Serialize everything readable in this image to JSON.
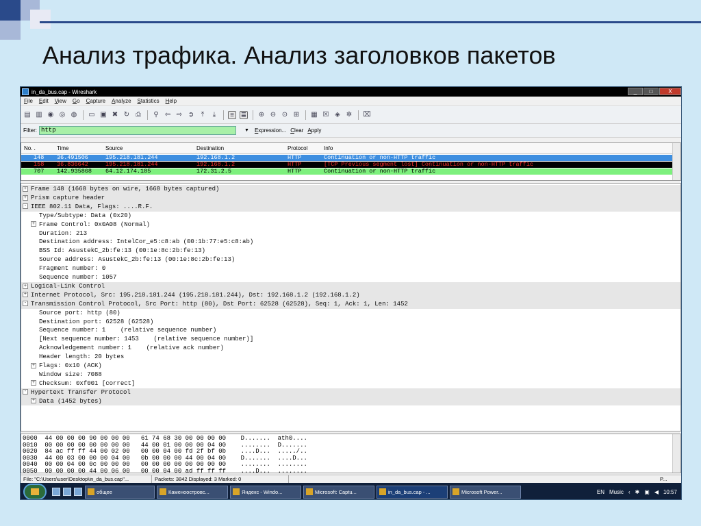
{
  "slide": {
    "title": "Анализ трафика. Анализ заголовков пакетов",
    "accent": "#2a4a8a"
  },
  "window": {
    "title": "in_da_bus.cap - Wireshark",
    "buttons": {
      "minimize": "_",
      "maximize": "□",
      "close": "X"
    }
  },
  "menu": [
    {
      "key": "F",
      "rest": "ile"
    },
    {
      "key": "E",
      "rest": "dit"
    },
    {
      "key": "V",
      "rest": "iew"
    },
    {
      "key": "G",
      "rest": "o"
    },
    {
      "key": "C",
      "rest": "apture"
    },
    {
      "key": "A",
      "rest": "nalyze"
    },
    {
      "key": "S",
      "rest": "tatistics"
    },
    {
      "key": "H",
      "rest": "elp"
    }
  ],
  "filter": {
    "label": "Filter:",
    "value": "http",
    "links": [
      "Expression...",
      "Clear",
      "Apply"
    ]
  },
  "packet_list": {
    "columns": [
      "No. .",
      "Time",
      "Source",
      "Destination",
      "Protocol",
      "Info"
    ],
    "rows": [
      {
        "no": "148",
        "time": "36.491506",
        "src": "195.218.181.244",
        "dst": "192.168.1.2",
        "proto": "HTTP",
        "info": "Continuation or non-HTTP traffic",
        "bg": "#3d8ee0",
        "fg": "#ffffff"
      },
      {
        "no": "158",
        "time": "36.836642",
        "src": "195.218.181.244",
        "dst": "192.168.1.2",
        "proto": "HTTP",
        "info": "[TCP Previous segment lost] Continuation or non-HTTP traffic",
        "bg": "#000000",
        "fg": "#ff3030"
      },
      {
        "no": "707",
        "time": "142.935868",
        "src": "64.12.174.185",
        "dst": "172.31.2.5",
        "proto": "HTTP",
        "info": "Continuation or non-HTTP traffic",
        "bg": "#7df07d",
        "fg": "#000000"
      }
    ]
  },
  "details": [
    {
      "exp": "+",
      "indent": 0,
      "text": "Frame 148 (1668 bytes on wire, 1668 bytes captured)",
      "hdr": true
    },
    {
      "exp": "+",
      "indent": 0,
      "text": "Prism capture header",
      "hdr": true
    },
    {
      "exp": "-",
      "indent": 0,
      "text": "IEEE 802.11 Data, Flags: ....R.F.",
      "hdr": true
    },
    {
      "exp": "",
      "indent": 1,
      "text": "Type/Subtype: Data (0x20)",
      "hdr": false
    },
    {
      "exp": "+",
      "indent": 1,
      "text": "Frame Control: 0x0A08 (Normal)",
      "hdr": false
    },
    {
      "exp": "",
      "indent": 1,
      "text": "Duration: 213",
      "hdr": false
    },
    {
      "exp": "",
      "indent": 1,
      "text": "Destination address: IntelCor_e5:c8:ab (00:1b:77:e5:c8:ab)",
      "hdr": false
    },
    {
      "exp": "",
      "indent": 1,
      "text": "BSS Id: AsustekC_2b:fe:13 (00:1e:8c:2b:fe:13)",
      "hdr": false
    },
    {
      "exp": "",
      "indent": 1,
      "text": "Source address: AsustekC_2b:fe:13 (00:1e:8c:2b:fe:13)",
      "hdr": false
    },
    {
      "exp": "",
      "indent": 1,
      "text": "Fragment number: 0",
      "hdr": false
    },
    {
      "exp": "",
      "indent": 1,
      "text": "Sequence number: 1057",
      "hdr": false
    },
    {
      "exp": "+",
      "indent": 0,
      "text": "Logical-Link Control",
      "hdr": true
    },
    {
      "exp": "+",
      "indent": 0,
      "text": "Internet Protocol, Src: 195.218.181.244 (195.218.181.244), Dst: 192.168.1.2 (192.168.1.2)",
      "hdr": true
    },
    {
      "exp": "-",
      "indent": 0,
      "text": "Transmission Control Protocol, Src Port: http (80), Dst Port: 62528 (62528), Seq: 1, Ack: 1, Len: 1452",
      "hdr": true
    },
    {
      "exp": "",
      "indent": 1,
      "text": "Source port: http (80)",
      "hdr": false
    },
    {
      "exp": "",
      "indent": 1,
      "text": "Destination port: 62528 (62528)",
      "hdr": false
    },
    {
      "exp": "",
      "indent": 1,
      "text": "Sequence number: 1    (relative sequence number)",
      "hdr": false
    },
    {
      "exp": "",
      "indent": 1,
      "text": "[Next sequence number: 1453    (relative sequence number)]",
      "hdr": false
    },
    {
      "exp": "",
      "indent": 1,
      "text": "Acknowledgement number: 1    (relative ack number)",
      "hdr": false
    },
    {
      "exp": "",
      "indent": 1,
      "text": "Header length: 20 bytes",
      "hdr": false
    },
    {
      "exp": "+",
      "indent": 1,
      "text": "Flags: 0x10 (ACK)",
      "hdr": false
    },
    {
      "exp": "",
      "indent": 1,
      "text": "Window size: 7088",
      "hdr": false
    },
    {
      "exp": "+",
      "indent": 1,
      "text": "Checksum: 0xf001 [correct]",
      "hdr": false
    },
    {
      "exp": "-",
      "indent": 0,
      "text": "Hypertext Transfer Protocol",
      "hdr": true
    },
    {
      "exp": "+",
      "indent": 1,
      "text": "Data (1452 bytes)",
      "hdr": true
    }
  ],
  "hex": [
    "0000  44 00 00 00 90 00 00 00   61 74 68 30 00 00 00 00    D.......  ath0....",
    "0010  00 00 00 00 00 00 00 00   44 00 01 00 00 00 04 00    ........  D.......",
    "0020  84 ac ff ff 44 00 02 00   00 00 04 00 fd 2f bf 0b    ....D...  ...../..",
    "0030  44 00 03 00 00 00 04 00   0b 00 00 00 44 00 04 00    D.......  ....D...",
    "0040  00 00 04 00 0c 00 00 00   00 00 00 00 00 00 00 00    ........  ........",
    "0050  00 00 00 00 44 00 06 00   00 00 04 00 ad ff ff ff    ....D...  ........"
  ],
  "status": {
    "file": "File: \"C:\\Users\\user\\Desktop\\in_da_bus.cap\"...",
    "packets": "Packets: 3842 Displayed: 3 Marked: 0",
    "profile": "P..."
  },
  "taskbar": {
    "tasks": [
      {
        "label": "общее",
        "active": false
      },
      {
        "label": "Каменоостровс...",
        "active": false
      },
      {
        "label": "Яндекс - Windo...",
        "active": false
      },
      {
        "label": "Microsoft: Captu...",
        "active": false
      },
      {
        "label": "in_da_bus.cap - ...",
        "active": true
      },
      {
        "label": "Microsoft Power...",
        "active": false
      }
    ],
    "lang": "EN",
    "music": "Music",
    "clock": "10:57"
  }
}
